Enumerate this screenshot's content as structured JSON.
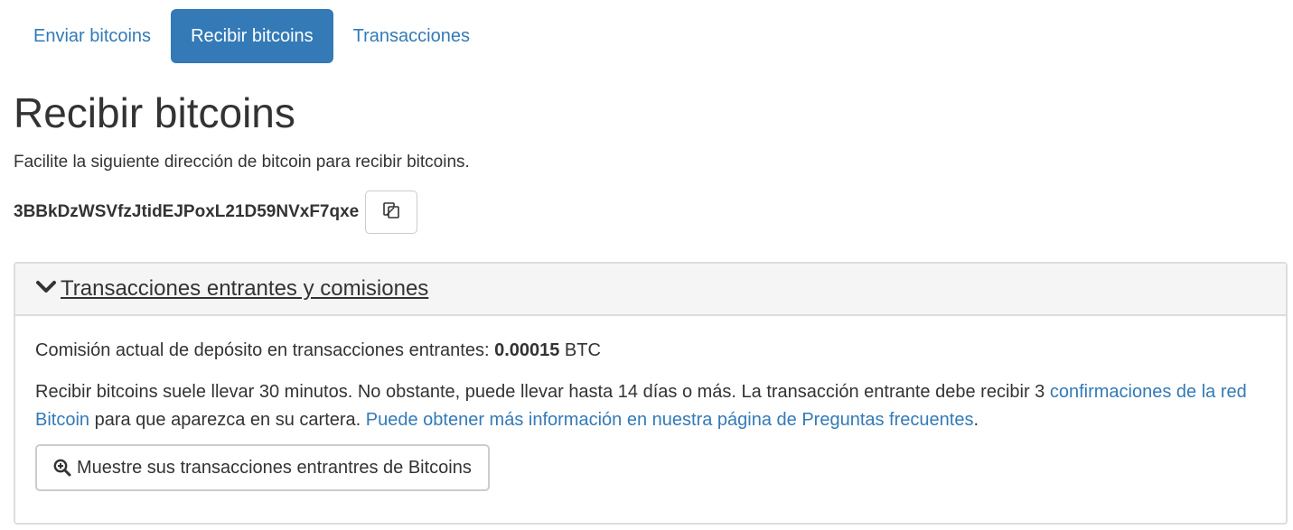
{
  "tabs": [
    {
      "label": "Enviar bitcoins",
      "active": false
    },
    {
      "label": "Recibir bitcoins",
      "active": true
    },
    {
      "label": "Transacciones",
      "active": false
    }
  ],
  "page": {
    "title": "Recibir bitcoins",
    "subtitle": "Facilite la siguiente dirección de bitcoin para recibir bitcoins.",
    "address": "3BBkDzWSVfzJtidEJPoxL21D59NVxF7qxe",
    "copy_icon": "copy-icon"
  },
  "panel": {
    "toggle_icon": "chevron-down-icon",
    "title": "Transacciones entrantes y comisiones",
    "fee_prefix": "Comisión actual de depósito en transacciones entrantes: ",
    "fee_value": "0.00015",
    "fee_unit": " BTC",
    "info_text_1": "Recibir bitcoins suele llevar 30 minutos. No obstante, puede llevar hasta 14 días o más. La transacción entrante debe recibir 3 ",
    "info_link_1": "confirmaciones de la red Bitcoin",
    "info_text_2": " para que aparezca en su cartera. ",
    "info_link_2": "Puede obtener más información en nuestra página de Preguntas frecuentes",
    "info_text_3": ".",
    "show_button_icon": "zoom-in-icon",
    "show_button_label": "Muestre sus transacciones entrantres de Bitcoins"
  },
  "colors": {
    "accent": "#337ab7",
    "text": "#333333",
    "panel_heading_bg": "#f5f5f5",
    "border": "#dddddd"
  }
}
